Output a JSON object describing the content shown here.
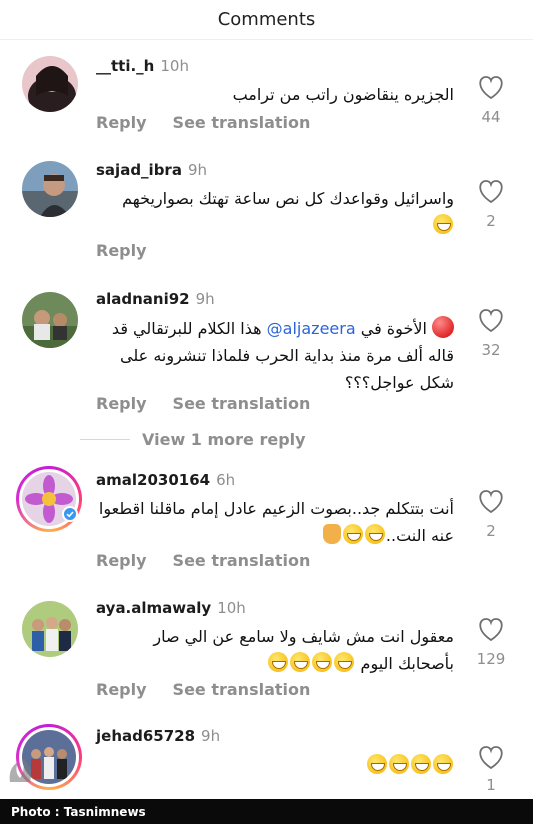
{
  "header": {
    "title": "Comments"
  },
  "actions": {
    "reply": "Reply",
    "see_translation": "See translation"
  },
  "comments": [
    {
      "username": "__tti._h",
      "time": "10h",
      "text": "الجزيره ينقاضون راتب من ترامب",
      "likes": "44"
    },
    {
      "username": "sajad_ibra",
      "time": "9h",
      "text": "واسرائيل وقواعدك كل نص ساعة تهتك بصواريخهم",
      "likes": "2"
    },
    {
      "username": "aladnani92",
      "time": "9h",
      "text_before": "الأخوة في ",
      "mention": "@aljazeera",
      "text_after": " هذا الكلام للبرتقالي قد قاله ألف مرة منذ بداية الحرب فلماذا تنشرونه على شكل عواجل؟؟؟",
      "likes": "32"
    },
    {
      "username": "amal2030164",
      "time": "6h",
      "text": "أنت بتتكلم جد..بصوت الزعيم عادل إمام ماقلنا اقطعوا عنه النت..",
      "likes": "2"
    },
    {
      "username": "aya.almawaly",
      "time": "10h",
      "text": "معقول انت مش شايف ولا سامع عن الي صار بأصحابك اليوم",
      "likes": "129"
    },
    {
      "username": "jehad65728",
      "time": "9h",
      "text": "",
      "likes": "1"
    }
  ],
  "view_more_replies": "View 1 more reply",
  "footer": {
    "credit": "Photo : Tasnimnews"
  },
  "colors": {
    "link": "#2c64d8",
    "muted": "#8e8e8e",
    "footer_bg": "#0a0a0a"
  },
  "icons": [
    "heart-icon",
    "verified-badge-icon",
    "watermark-logo-icon"
  ]
}
